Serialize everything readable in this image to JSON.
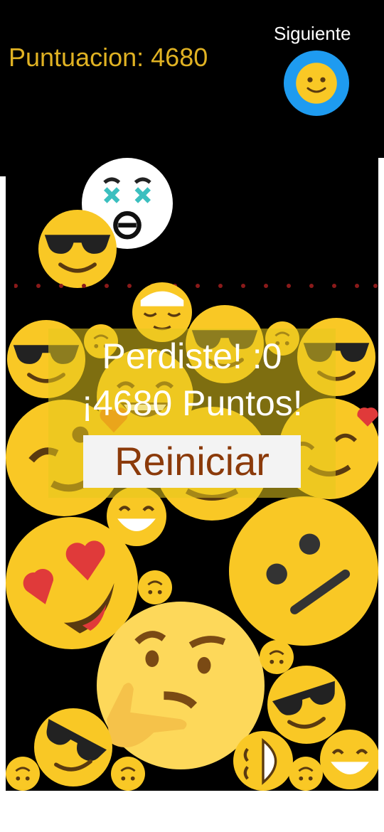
{
  "hud": {
    "score_text": "Puntuacion: 4680",
    "next_label": "Siguiente",
    "next_emoji_icon": "slightly-smiling-face-icon",
    "next_ring_color": "#1e9bf0",
    "score_color": "#e0b223"
  },
  "game_over": {
    "title": "Perdiste! :0",
    "points_text": "¡4680 Puntos!",
    "restart_label": "Reiniciar"
  },
  "colors": {
    "emoji_yellow": "#f9c825",
    "background": "#000000",
    "overlay": "#e6c81e"
  },
  "board_emojis": [
    "dizzy-face-icon",
    "sunglasses-face-icon",
    "relieved-face-icon",
    "sunglasses-face-icon",
    "sunglasses-face-icon",
    "sunglasses-face-icon",
    "winking-face-icon",
    "smiling-hearts-face-icon",
    "grinning-face-icon",
    "heart-eyes-face-icon",
    "neutral-face-icon",
    "thinking-face-icon",
    "sunglasses-face-icon",
    "sunglasses-face-icon",
    "grinning-face-icon",
    "laughing-face-icon",
    "upside-down-face-icon"
  ]
}
